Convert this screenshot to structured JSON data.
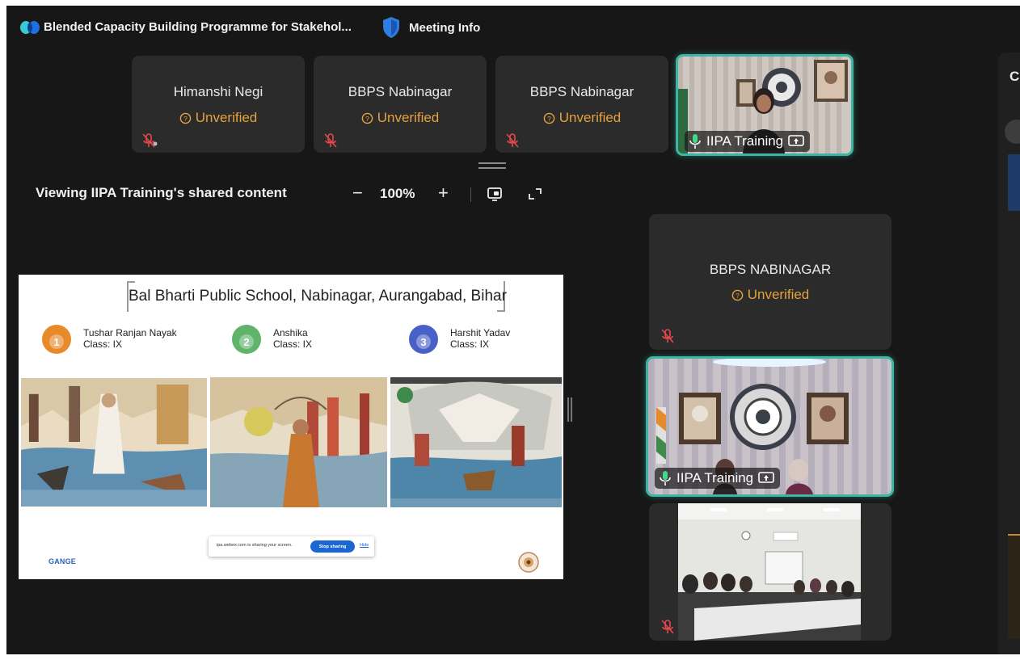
{
  "meeting": {
    "title": "Blended Capacity Building Programme for Stakehol...",
    "info_label": "Meeting Info"
  },
  "top_strip": [
    {
      "name": "Himanshi Negi",
      "status": "Unverified",
      "muted": true
    },
    {
      "name": "BBPS Nabinagar",
      "status": "Unverified",
      "muted": true
    },
    {
      "name": "BBPS Nabinagar",
      "status": "Unverified",
      "muted": true
    },
    {
      "name": "IIPA Training",
      "video": true,
      "active_speaker": true,
      "sharing": true
    }
  ],
  "share_toolbar": {
    "viewing_text": "Viewing IIPA Training's shared content",
    "zoom_minus": "−",
    "zoom_value": "100%",
    "zoom_plus": "+",
    "icons": [
      "pop-out-icon",
      "fullscreen-icon"
    ]
  },
  "shared_slide": {
    "title": "Bal Bharti Public School, Nabinagar, Aurangabad, Bihar",
    "winners": [
      {
        "rank": "1",
        "name": "Tushar Ranjan Nayak",
        "class": "Class: IX",
        "medal_color": "#e8892a"
      },
      {
        "rank": "2",
        "name": "Anshika",
        "class": "Class: IX",
        "medal_color": "#5fb36a"
      },
      {
        "rank": "3",
        "name": "Harshit Yadav",
        "class": "Class: IX",
        "medal_color": "#4a60c9"
      }
    ],
    "share_notice": {
      "text": "ipa.webex.com is sharing your screen.",
      "stop_label": "Stop sharing",
      "hide_label": "Hide"
    },
    "logo_text": "GANGE"
  },
  "side_tiles": [
    {
      "name": "BBPS NABINAGAR",
      "status": "Unverified",
      "muted": true
    },
    {
      "name": "IIPA Training",
      "video": true,
      "active_speaker": true,
      "sharing": true
    },
    {
      "video": true,
      "muted": true
    }
  ],
  "right_panel": {
    "letter": "C"
  },
  "colors": {
    "background": "#171717",
    "tile": "#2b2b2b",
    "unverified": "#e6a23c",
    "active_border": "#3bb6a4",
    "mute_icon": "#e5484d"
  }
}
